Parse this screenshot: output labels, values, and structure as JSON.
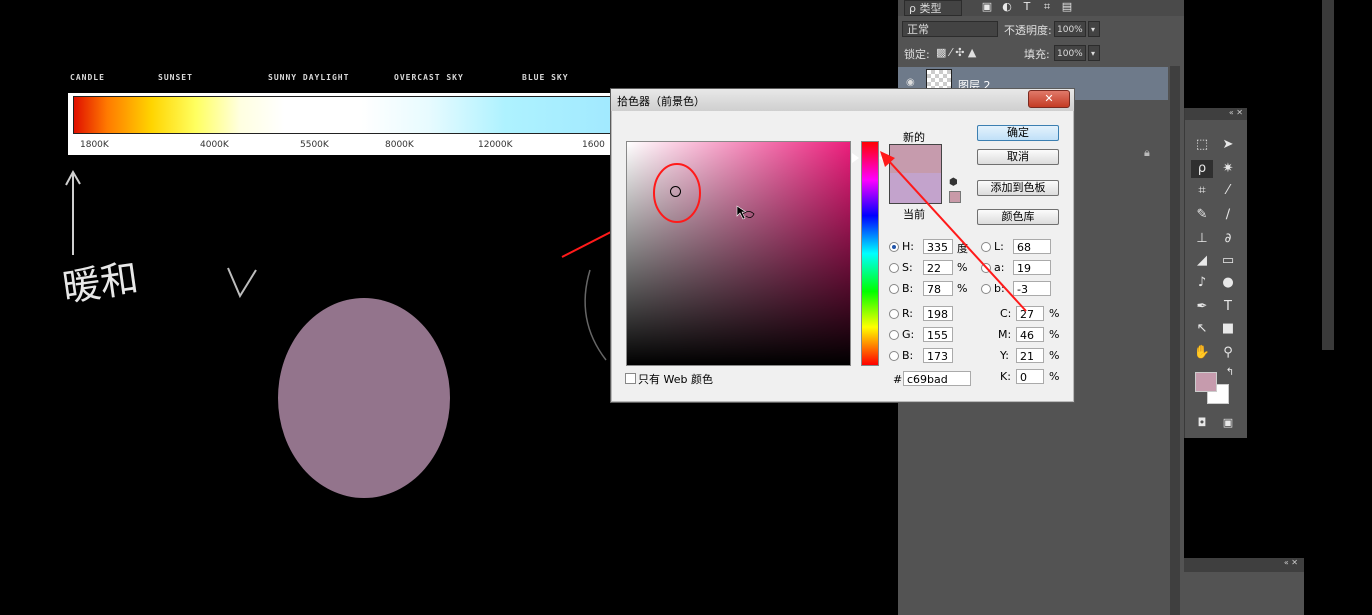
{
  "canvas": {
    "scale_labels": [
      "CANDLE",
      "SUNSET",
      "SUNNY DAYLIGHT",
      "OVERCAST SKY",
      "BLUE SKY"
    ],
    "kelvin_labels": [
      "1800K",
      "4000K",
      "5500K",
      "8000K",
      "12000K",
      "1600"
    ],
    "handwriting": "暖和",
    "painted_circle_color": "#93748c"
  },
  "dialog": {
    "title": "拾色器（前景色）",
    "close_label": "✕",
    "new_label": "新的",
    "current_label": "当前",
    "new_color": "#c69bad",
    "current_color": "#c3a3cc",
    "buttons": {
      "ok": "确定",
      "cancel": "取消",
      "add_to_swatches": "添加到色板",
      "color_libraries": "颜色库"
    },
    "fields": {
      "H": {
        "label": "H:",
        "value": "335",
        "unit": "度"
      },
      "S": {
        "label": "S:",
        "value": "22",
        "unit": "%"
      },
      "B": {
        "label": "B:",
        "value": "78",
        "unit": "%"
      },
      "R": {
        "label": "R:",
        "value": "198"
      },
      "G": {
        "label": "G:",
        "value": "155"
      },
      "Bl": {
        "label": "B:",
        "value": "173"
      },
      "L": {
        "label": "L:",
        "value": "68"
      },
      "a": {
        "label": "a:",
        "value": "19"
      },
      "b": {
        "label": "b:",
        "value": "-3"
      },
      "C": {
        "label": "C:",
        "value": "27",
        "unit": "%"
      },
      "M": {
        "label": "M:",
        "value": "46",
        "unit": "%"
      },
      "Y": {
        "label": "Y:",
        "value": "21",
        "unit": "%"
      },
      "K": {
        "label": "K:",
        "value": "0",
        "unit": "%"
      }
    },
    "hex_label": "#",
    "hex_value": "c69bad",
    "web_only_label": "只有 Web 颜色"
  },
  "layers_panel": {
    "filter_kind": "ρ 类型",
    "blend_mode": "正常",
    "opacity_label": "不透明度:",
    "opacity_value": "100%",
    "lock_label": "锁定:",
    "fill_label": "填充:",
    "fill_value": "100%",
    "layer_name": "图层 2"
  },
  "colors": {
    "annotation_red": "#ff1a1a",
    "foreground": "#c69bad",
    "background": "#ffffff"
  }
}
